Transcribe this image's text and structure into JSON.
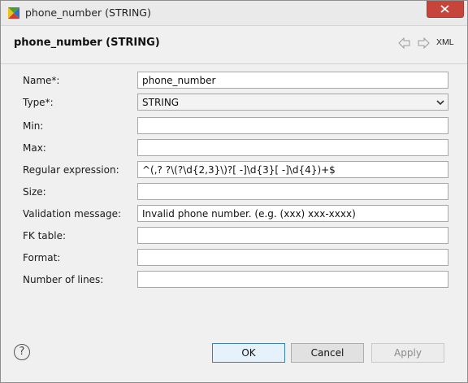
{
  "window": {
    "title": "phone_number (STRING)"
  },
  "header": {
    "title": "phone_number (STRING)",
    "xml_label": "XML",
    "back_icon": "arrow-left-icon",
    "forward_icon": "arrow-right-icon"
  },
  "form": {
    "fields": [
      {
        "label": "Name*:",
        "value": "phone_number",
        "kind": "text"
      },
      {
        "label": "Type*:",
        "value": "STRING",
        "kind": "select"
      },
      {
        "label": "Min:",
        "value": "",
        "kind": "text"
      },
      {
        "label": "Max:",
        "value": "",
        "kind": "text"
      },
      {
        "label": "Regular expression:",
        "value": "^(,? ?\\(?\\d{2,3}\\)?[ -]\\d{3}[ -]\\d{4})+$",
        "kind": "text"
      },
      {
        "label": "Size:",
        "value": "",
        "kind": "text"
      },
      {
        "label": "Validation message:",
        "value": "Invalid phone number. (e.g. (xxx) xxx-xxxx)",
        "kind": "text"
      },
      {
        "label": "FK table:",
        "value": "",
        "kind": "text"
      },
      {
        "label": "Format:",
        "value": "",
        "kind": "text"
      },
      {
        "label": "Number of lines:",
        "value": "",
        "kind": "text"
      }
    ]
  },
  "footer": {
    "help_label": "?",
    "ok_label": "OK",
    "cancel_label": "Cancel",
    "apply_label": "Apply"
  },
  "colors": {
    "close_button": "#c7443b",
    "ok_border": "#3c7fb1"
  }
}
